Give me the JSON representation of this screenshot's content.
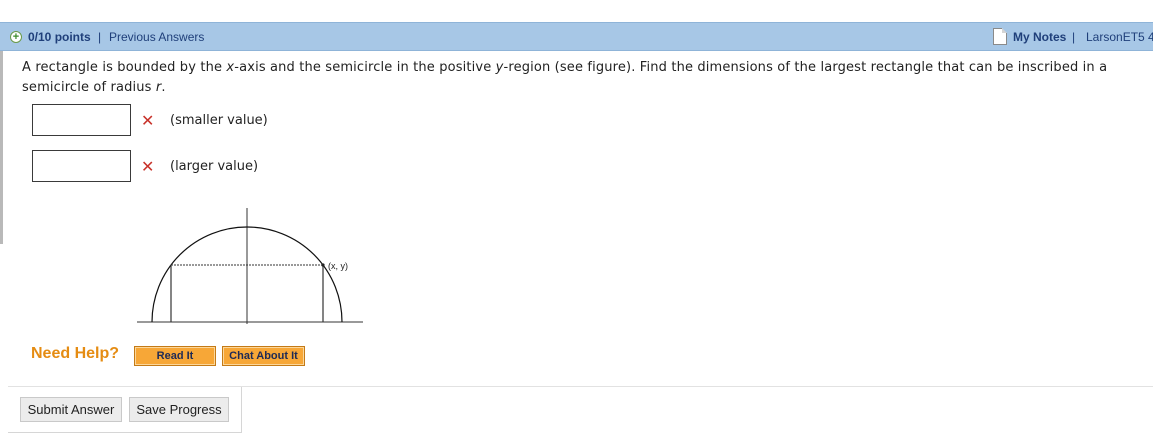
{
  "header": {
    "points": "0/10 points",
    "separator": "|",
    "previous_answers": "Previous Answers",
    "my_notes": "My Notes",
    "course_code": "LarsonET5 4"
  },
  "question": {
    "text_html": "A rectangle is bounded by the <i>x</i>-axis and the semicircle in the positive <i>y</i>-region (see figure). Find the dimensions of the largest rectangle that can be inscribed in a semicircle of radius <i>r</i>."
  },
  "answers": [
    {
      "value": "",
      "hint": "(smaller value)",
      "status": "incorrect"
    },
    {
      "value": "",
      "hint": "(larger value)",
      "status": "incorrect"
    }
  ],
  "figure": {
    "point_label": "(x, y)"
  },
  "help": {
    "label": "Need Help?",
    "read_it": "Read It",
    "chat_about_it": "Chat About It"
  },
  "actions": {
    "submit": "Submit Answer",
    "save": "Save Progress"
  },
  "colors": {
    "header_bg": "#a7c7e6",
    "link": "#1f3f7a",
    "need_help": "#e58c13",
    "help_button": "#f7a737",
    "incorrect_mark": "#c8322a"
  }
}
